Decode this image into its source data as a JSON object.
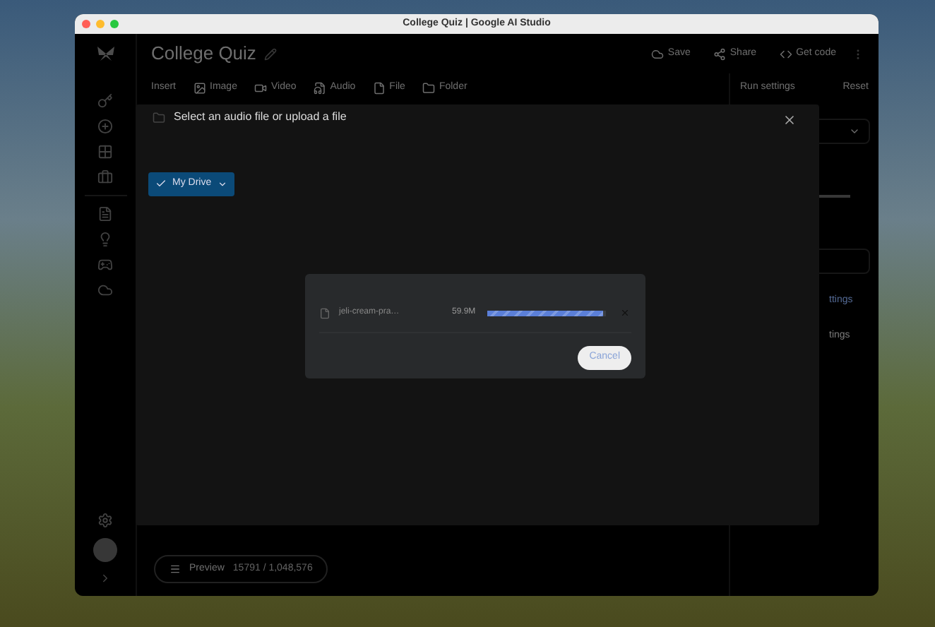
{
  "window": {
    "title": "College Quiz | Google AI Studio"
  },
  "header": {
    "title": "College Quiz",
    "actions": [
      {
        "kind": "save",
        "label": "Save"
      },
      {
        "kind": "share",
        "label": "Share"
      },
      {
        "kind": "code",
        "label": "Get code"
      }
    ]
  },
  "toolbar": {
    "label": "Insert",
    "items": [
      {
        "kind": "image",
        "label": "Image"
      },
      {
        "kind": "video",
        "label": "Video"
      },
      {
        "kind": "audio",
        "label": "Audio"
      },
      {
        "kind": "file",
        "label": "File"
      },
      {
        "kind": "folder",
        "label": "Folder"
      }
    ]
  },
  "run_settings": {
    "title": "Run settings",
    "reset": "Reset",
    "links": [
      "ttings",
      "tings"
    ]
  },
  "preview": {
    "label": "Preview",
    "tokens": "15791 / 1,048,576"
  },
  "dialog": {
    "title": "Select an audio file or upload a file",
    "source": {
      "label": "My Drive",
      "selected": true
    },
    "upload": {
      "filename": "jeli-cream-pra…",
      "size": "59.9M",
      "level": 0.98
    },
    "cancel": "Cancel"
  }
}
